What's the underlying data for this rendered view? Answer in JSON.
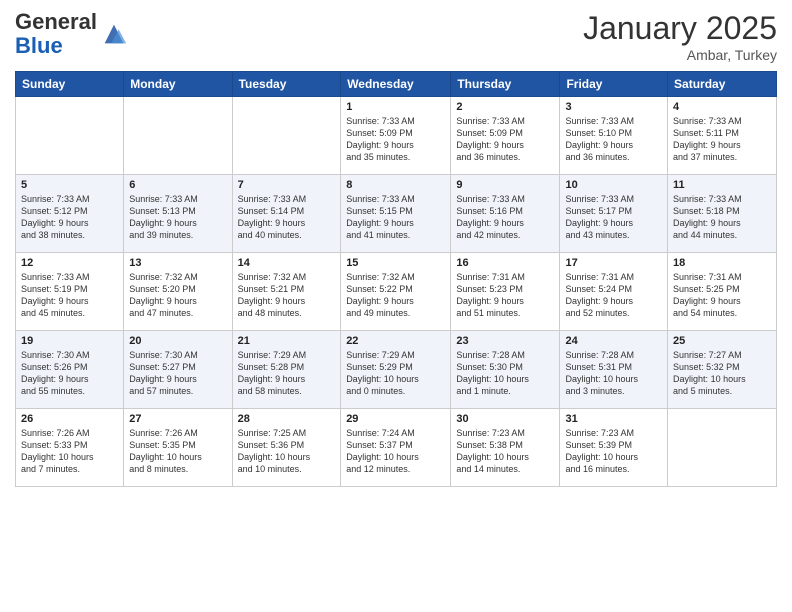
{
  "logo": {
    "general": "General",
    "blue": "Blue"
  },
  "title": "January 2025",
  "location": "Ambar, Turkey",
  "days_header": [
    "Sunday",
    "Monday",
    "Tuesday",
    "Wednesday",
    "Thursday",
    "Friday",
    "Saturday"
  ],
  "weeks": [
    [
      {
        "day": "",
        "info": ""
      },
      {
        "day": "",
        "info": ""
      },
      {
        "day": "",
        "info": ""
      },
      {
        "day": "1",
        "info": "Sunrise: 7:33 AM\nSunset: 5:09 PM\nDaylight: 9 hours\nand 35 minutes."
      },
      {
        "day": "2",
        "info": "Sunrise: 7:33 AM\nSunset: 5:09 PM\nDaylight: 9 hours\nand 36 minutes."
      },
      {
        "day": "3",
        "info": "Sunrise: 7:33 AM\nSunset: 5:10 PM\nDaylight: 9 hours\nand 36 minutes."
      },
      {
        "day": "4",
        "info": "Sunrise: 7:33 AM\nSunset: 5:11 PM\nDaylight: 9 hours\nand 37 minutes."
      }
    ],
    [
      {
        "day": "5",
        "info": "Sunrise: 7:33 AM\nSunset: 5:12 PM\nDaylight: 9 hours\nand 38 minutes."
      },
      {
        "day": "6",
        "info": "Sunrise: 7:33 AM\nSunset: 5:13 PM\nDaylight: 9 hours\nand 39 minutes."
      },
      {
        "day": "7",
        "info": "Sunrise: 7:33 AM\nSunset: 5:14 PM\nDaylight: 9 hours\nand 40 minutes."
      },
      {
        "day": "8",
        "info": "Sunrise: 7:33 AM\nSunset: 5:15 PM\nDaylight: 9 hours\nand 41 minutes."
      },
      {
        "day": "9",
        "info": "Sunrise: 7:33 AM\nSunset: 5:16 PM\nDaylight: 9 hours\nand 42 minutes."
      },
      {
        "day": "10",
        "info": "Sunrise: 7:33 AM\nSunset: 5:17 PM\nDaylight: 9 hours\nand 43 minutes."
      },
      {
        "day": "11",
        "info": "Sunrise: 7:33 AM\nSunset: 5:18 PM\nDaylight: 9 hours\nand 44 minutes."
      }
    ],
    [
      {
        "day": "12",
        "info": "Sunrise: 7:33 AM\nSunset: 5:19 PM\nDaylight: 9 hours\nand 45 minutes."
      },
      {
        "day": "13",
        "info": "Sunrise: 7:32 AM\nSunset: 5:20 PM\nDaylight: 9 hours\nand 47 minutes."
      },
      {
        "day": "14",
        "info": "Sunrise: 7:32 AM\nSunset: 5:21 PM\nDaylight: 9 hours\nand 48 minutes."
      },
      {
        "day": "15",
        "info": "Sunrise: 7:32 AM\nSunset: 5:22 PM\nDaylight: 9 hours\nand 49 minutes."
      },
      {
        "day": "16",
        "info": "Sunrise: 7:31 AM\nSunset: 5:23 PM\nDaylight: 9 hours\nand 51 minutes."
      },
      {
        "day": "17",
        "info": "Sunrise: 7:31 AM\nSunset: 5:24 PM\nDaylight: 9 hours\nand 52 minutes."
      },
      {
        "day": "18",
        "info": "Sunrise: 7:31 AM\nSunset: 5:25 PM\nDaylight: 9 hours\nand 54 minutes."
      }
    ],
    [
      {
        "day": "19",
        "info": "Sunrise: 7:30 AM\nSunset: 5:26 PM\nDaylight: 9 hours\nand 55 minutes."
      },
      {
        "day": "20",
        "info": "Sunrise: 7:30 AM\nSunset: 5:27 PM\nDaylight: 9 hours\nand 57 minutes."
      },
      {
        "day": "21",
        "info": "Sunrise: 7:29 AM\nSunset: 5:28 PM\nDaylight: 9 hours\nand 58 minutes."
      },
      {
        "day": "22",
        "info": "Sunrise: 7:29 AM\nSunset: 5:29 PM\nDaylight: 10 hours\nand 0 minutes."
      },
      {
        "day": "23",
        "info": "Sunrise: 7:28 AM\nSunset: 5:30 PM\nDaylight: 10 hours\nand 1 minute."
      },
      {
        "day": "24",
        "info": "Sunrise: 7:28 AM\nSunset: 5:31 PM\nDaylight: 10 hours\nand 3 minutes."
      },
      {
        "day": "25",
        "info": "Sunrise: 7:27 AM\nSunset: 5:32 PM\nDaylight: 10 hours\nand 5 minutes."
      }
    ],
    [
      {
        "day": "26",
        "info": "Sunrise: 7:26 AM\nSunset: 5:33 PM\nDaylight: 10 hours\nand 7 minutes."
      },
      {
        "day": "27",
        "info": "Sunrise: 7:26 AM\nSunset: 5:35 PM\nDaylight: 10 hours\nand 8 minutes."
      },
      {
        "day": "28",
        "info": "Sunrise: 7:25 AM\nSunset: 5:36 PM\nDaylight: 10 hours\nand 10 minutes."
      },
      {
        "day": "29",
        "info": "Sunrise: 7:24 AM\nSunset: 5:37 PM\nDaylight: 10 hours\nand 12 minutes."
      },
      {
        "day": "30",
        "info": "Sunrise: 7:23 AM\nSunset: 5:38 PM\nDaylight: 10 hours\nand 14 minutes."
      },
      {
        "day": "31",
        "info": "Sunrise: 7:23 AM\nSunset: 5:39 PM\nDaylight: 10 hours\nand 16 minutes."
      },
      {
        "day": "",
        "info": ""
      }
    ]
  ]
}
